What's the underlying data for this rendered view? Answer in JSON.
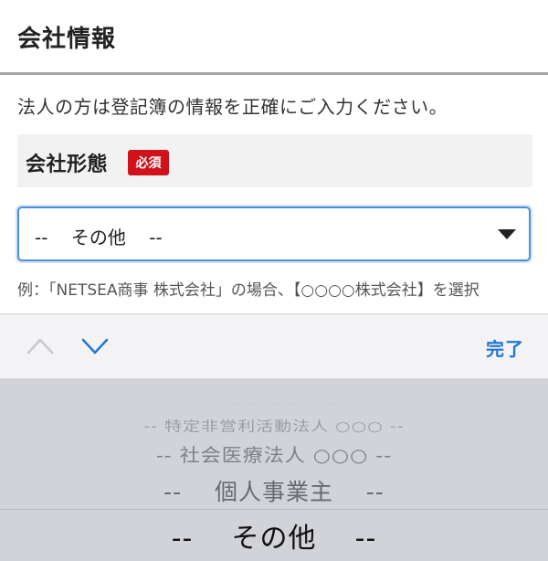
{
  "header": {
    "title": "会社情報"
  },
  "instruction": "法人の方は登記簿の情報を正確にご入力ください。",
  "field": {
    "label": "会社形態",
    "required_badge": "必須",
    "selected_value": "--    その他    --"
  },
  "example_text": "例：「NETSEA商事 株式会社」の場合、【○○○○株式会社】を選択",
  "accessory_bar": {
    "done_label": "完了"
  },
  "picker": {
    "items": [
      "-- 特定非営利活動法人 ○○○ --",
      "-- 社会医療法人 ○○○ --",
      "--    個人事業主    --",
      "--    その他    --"
    ]
  },
  "colors": {
    "required_badge": "#d0121b",
    "select_focus_border": "#4a90d9",
    "done_button": "#2176d6",
    "picker_background": "#d1d3d9"
  }
}
